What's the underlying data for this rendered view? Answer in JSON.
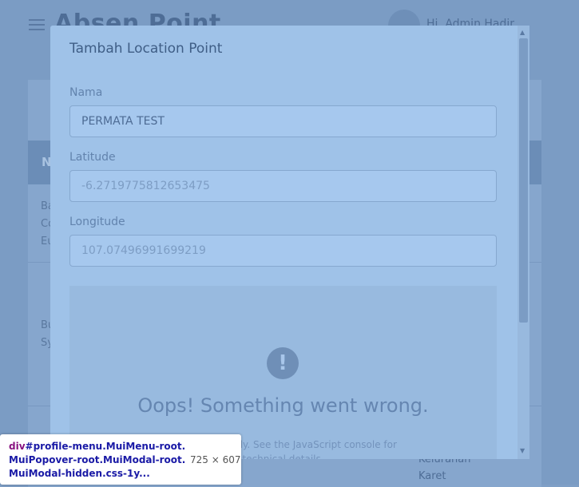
{
  "page": {
    "title": "Absen Point",
    "greeting": "Hi, Admin Hadir",
    "table_header": "No",
    "rows": [
      {
        "lines": [
          "Ba",
          "Co",
          "Eu"
        ]
      },
      {
        "lines": [
          "Bu",
          "Sy"
        ]
      }
    ],
    "right_text": [
      "Kelurahan",
      "Karet"
    ]
  },
  "modal": {
    "title": "Tambah Location Point",
    "fields": [
      {
        "label": "Nama",
        "value": "PERMATA TEST"
      },
      {
        "label": "Latitude",
        "value": "-6.2719775812653475"
      },
      {
        "label": "Longitude",
        "value": "107.07496991699219"
      }
    ],
    "map": {
      "error_icon": "!",
      "error_title": "Oops! Something went wrong.",
      "error_detail_1": "e Maps correctly. See the JavaScript console for",
      "error_detail_2": "technical details."
    }
  },
  "devtools_tooltip": {
    "tag": "div",
    "selector": "#profile-menu.MuiMenu-root.MuiPopover-root.MuiModal-root.MuiModal-hidden.css-1y...",
    "size": "725 × 607"
  }
}
